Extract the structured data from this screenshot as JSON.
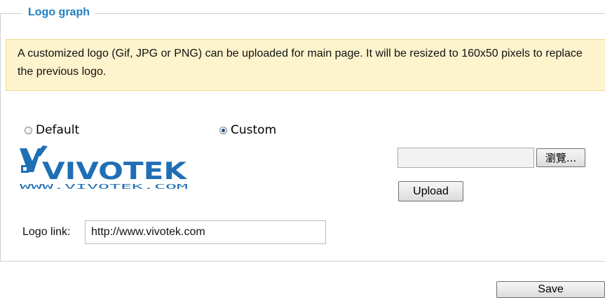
{
  "section": {
    "legend": "Logo graph",
    "notice": "A customized logo (Gif, JPG or PNG) can be uploaded for main page. It will be resized to 160x50 pixels to replace the previous logo."
  },
  "options": {
    "default_label": "Default",
    "custom_label": "Custom",
    "selected": "Custom"
  },
  "logo": {
    "brand_text": "VIVOTEK",
    "url_text": "WWW.VIVOTEK.COM",
    "brand_color": "#1f6fb5"
  },
  "upload": {
    "file_value": "",
    "browse_label": "瀏覽...",
    "upload_label": "Upload"
  },
  "logo_link": {
    "label": "Logo link:",
    "value": "http://www.vivotek.com"
  },
  "footer": {
    "save_label": "Save"
  }
}
